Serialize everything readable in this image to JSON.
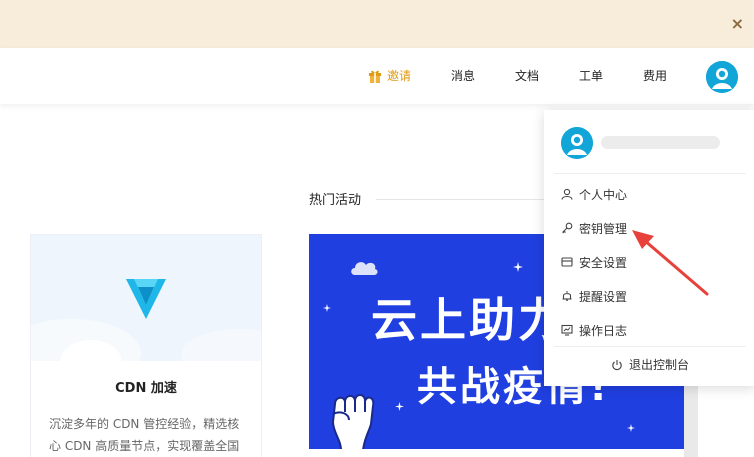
{
  "notice": {
    "close_glyph": "×"
  },
  "header": {
    "nav": {
      "invite": "邀请",
      "messages": "消息",
      "docs": "文档",
      "tickets": "工单",
      "billing": "费用"
    },
    "accent_color": "#e09a12"
  },
  "main": {
    "section_title": "热门活动",
    "product_card": {
      "title": "CDN 加速",
      "description": "沉淀多年的 CDN 管控经验，精选核心 CDN 高质量节点，实现覆盖全国"
    },
    "banner": {
      "line1": "云上助力",
      "line2": "共战疫情!",
      "background": "#1f3fe0"
    }
  },
  "dropdown": {
    "items": [
      {
        "label": "个人中心",
        "icon": "user-icon"
      },
      {
        "label": "密钥管理",
        "icon": "key-icon"
      },
      {
        "label": "安全设置",
        "icon": "shield-icon"
      },
      {
        "label": "提醒设置",
        "icon": "bell-icon"
      },
      {
        "label": "操作日志",
        "icon": "log-icon"
      }
    ],
    "logout": "退出控制台",
    "avatar_color": "#12a5d8"
  },
  "annotation": {
    "arrow_color": "#e8403a"
  }
}
